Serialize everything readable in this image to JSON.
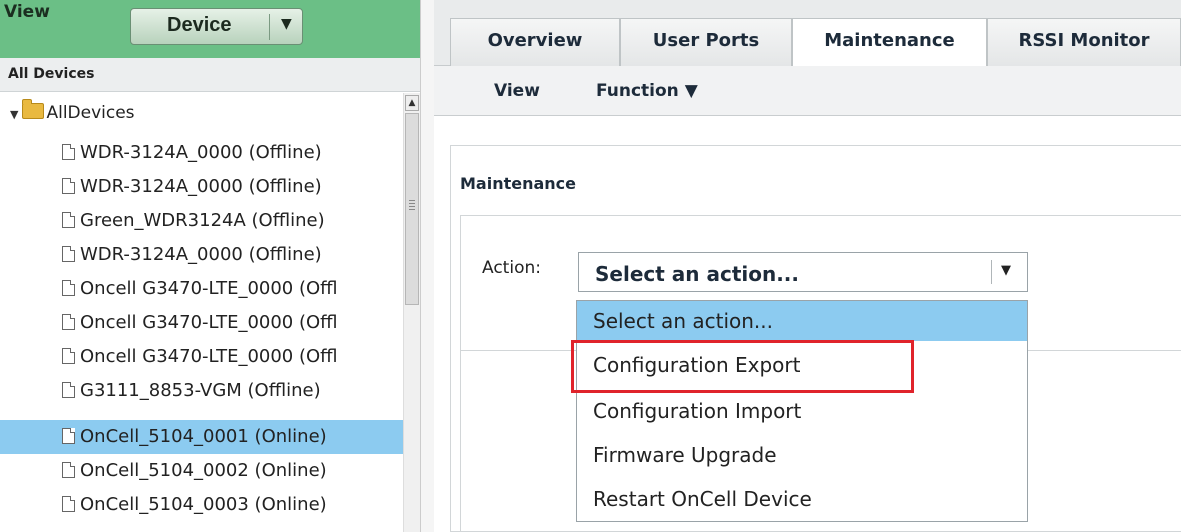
{
  "left_panel": {
    "view_label": "View",
    "device_button": {
      "label": "Device",
      "arrow": "▼"
    },
    "section_title": "All Devices",
    "tree": {
      "root_label": "AllDevices",
      "items": [
        {
          "label": "WDR-3124A_0000 (Offline)",
          "selected": false
        },
        {
          "label": "WDR-3124A_0000 (Offline)",
          "selected": false
        },
        {
          "label": "Green_WDR3124A (Offline)",
          "selected": false
        },
        {
          "label": "WDR-3124A_0000 (Offline)",
          "selected": false
        },
        {
          "label": "Oncell G3470-LTE_0000 (Offl",
          "selected": false
        },
        {
          "label": "Oncell G3470-LTE_0000 (Offl",
          "selected": false
        },
        {
          "label": "Oncell G3470-LTE_0000 (Offl",
          "selected": false
        },
        {
          "label": "G3111_8853-VGM (Offline)",
          "selected": false
        },
        {
          "label": "OnCell_5104_0001 (Online)",
          "selected": true
        },
        {
          "label": "OnCell_5104_0002 (Online)",
          "selected": false
        },
        {
          "label": "OnCell_5104_0003 (Online)",
          "selected": false
        }
      ]
    }
  },
  "tabs": [
    {
      "label": "Overview",
      "active": false
    },
    {
      "label": "User Ports",
      "active": false
    },
    {
      "label": "Maintenance",
      "active": true
    },
    {
      "label": "RSSI Monitor",
      "active": false
    }
  ],
  "toolbar": {
    "view_label": "View",
    "function_label": "Function ▼"
  },
  "maintenance": {
    "title": "Maintenance",
    "action_label": "Action:",
    "select_value": "Select an action...",
    "options": [
      "Select an action...",
      "Configuration Export",
      "Configuration Import",
      "Firmware Upgrade",
      "Restart OnCell Device"
    ],
    "highlighted_option": "Select an action...",
    "outlined_option": "Configuration Export"
  },
  "colors": {
    "view_bar": "#6bbf86",
    "selection": "#8ccbf0",
    "outline": "#e0232b"
  }
}
